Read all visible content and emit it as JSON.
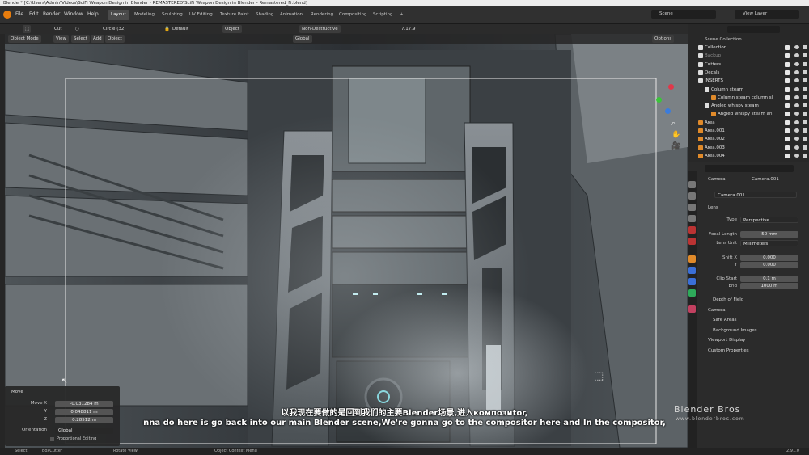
{
  "window": {
    "title": "Blender* [C:\\Users\\Admin\\Videos\\SciFi Weapon Design in Blender - REMASTERED\\SciFi Weapon Design in Blender - Remastered_Fi.blend]"
  },
  "menu": [
    "File",
    "Edit",
    "Render",
    "Window",
    "Help"
  ],
  "workspaces": [
    "Layout",
    "Modeling",
    "Sculpting",
    "UV Editing",
    "Texture Paint",
    "Shading",
    "Animation",
    "Rendering",
    "Compositing",
    "Scripting",
    "+"
  ],
  "active_workspace": "Layout",
  "scene": {
    "name": "Scene",
    "view_layer": "View Layer"
  },
  "toolbar": {
    "tool": "Cut",
    "brush": "Circle (32)",
    "default": "Default",
    "object": "Object",
    "non_destructive": "Non-Destructive",
    "version": "7.17.9"
  },
  "viewport_header": {
    "mode": "Object Mode",
    "view": "View",
    "select": "Select",
    "add": "Add",
    "object": "Object",
    "orientation": "Global",
    "options": "Options"
  },
  "outliner": {
    "title": "Scene Collection",
    "items": [
      {
        "name": "Collection",
        "color": "#e0e0e0"
      },
      {
        "name": "Backup",
        "color": "#8a8a8a"
      },
      {
        "name": "Cutters",
        "color": "#e0e0e0"
      },
      {
        "name": "Decals",
        "color": "#e0e0e0"
      },
      {
        "name": "INSERTS",
        "color": "#e0e0e0"
      },
      {
        "name": "Column steam",
        "color": "#e0e0e0"
      },
      {
        "name": "Column steam column sl",
        "color": "#e0e0e0"
      },
      {
        "name": "Angled whispy steam",
        "color": "#e0e0e0"
      },
      {
        "name": "Angled whispy steam an",
        "color": "#e0e0e0"
      },
      {
        "name": "Area",
        "color": "#e0e0e0"
      },
      {
        "name": "Area.001",
        "color": "#e0e0e0"
      },
      {
        "name": "Area.002",
        "color": "#e0e0e0"
      },
      {
        "name": "Area.003",
        "color": "#e0e0e0"
      },
      {
        "name": "Area.004",
        "color": "#e0e0e0"
      }
    ]
  },
  "properties": {
    "breadcrumb_obj": "Camera",
    "breadcrumb_data": "Camera.001",
    "data_name": "Camera.001",
    "lens_section": "Lens",
    "type_label": "Type",
    "type_value": "Perspective",
    "focal_label": "Focal Length",
    "focal_value": "50 mm",
    "lensunit_label": "Lens Unit",
    "lensunit_value": "Millimeters",
    "shiftx_label": "Shift X",
    "shiftx_value": "0.000",
    "y_label": "Y",
    "y_value": "0.000",
    "clipstart_label": "Clip Start",
    "clipstart_value": "0.1 m",
    "end_label": "End",
    "end_value": "1000 m",
    "sections": [
      "Depth of Field",
      "Camera",
      "Safe Areas",
      "Background Images",
      "Viewport Display",
      "Custom Properties"
    ]
  },
  "move_panel": {
    "title": "Move",
    "move_x_label": "Move X",
    "move_x": "-0.031284 m",
    "y_label": "Y",
    "y": "0.048811 m",
    "z_label": "Z",
    "z": "0.28512 m",
    "orientation_label": "Orientation",
    "orientation": "Global",
    "proportional": "Proportional Editing"
  },
  "subtitles": {
    "line1": "以我现在要做的是回到我们的主要Blender场景,进入композиtor,",
    "line2": "nna do here is go back into our main Blender scene,We're gonna go to the compositor here and In the compositor,"
  },
  "watermark": {
    "brand": "Blender Bros",
    "url": "www.blenderbros.com"
  },
  "statusbar": {
    "select": "Select",
    "boxcutter": "BoxCutter",
    "rotate": "Rotate View",
    "context": "Object Context Menu",
    "version": "2.91.0"
  }
}
